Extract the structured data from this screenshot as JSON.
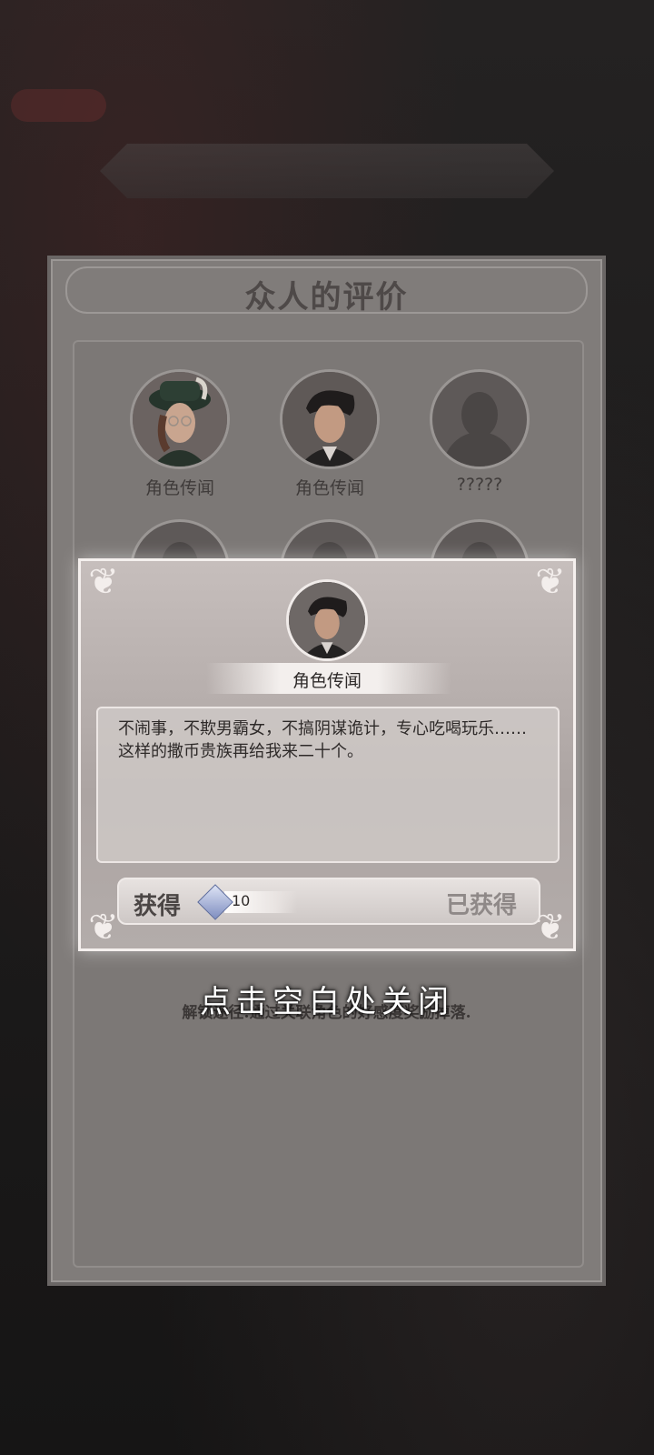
{
  "panel": {
    "title": "众人的评价",
    "hint": "解锁途径:通过关联角色的好感度奖励掉落."
  },
  "characters": [
    {
      "label": "角色传闻",
      "icon": "lady-portrait-icon"
    },
    {
      "label": "角色传闻",
      "icon": "man-portrait-icon"
    },
    {
      "label": "?????",
      "icon": "silhouette-icon"
    },
    {
      "label": "?????",
      "icon": "silhouette-icon"
    },
    {
      "label": "?????",
      "icon": "silhouette-icon"
    },
    {
      "label": "?????",
      "icon": "silhouette-icon"
    },
    {
      "label": "?????",
      "icon": "silhouette-icon"
    },
    {
      "label": "?????",
      "icon": "silhouette-icon"
    },
    {
      "label": "?????",
      "icon": "silhouette-icon"
    },
    {
      "label": "?????",
      "icon": "silhouette-icon"
    }
  ],
  "popup": {
    "name": "角色传闻",
    "quote": "不闹事，不欺男霸女，不搞阴谋诡计，专心吃喝玩乐……这样的撒币贵族再给我来二十个。",
    "reward_label": "获得",
    "reward_icon": "crystal-currency-icon",
    "reward_amount": "10",
    "reward_status": "已获得"
  },
  "close_hint": "点击空白处关闭"
}
